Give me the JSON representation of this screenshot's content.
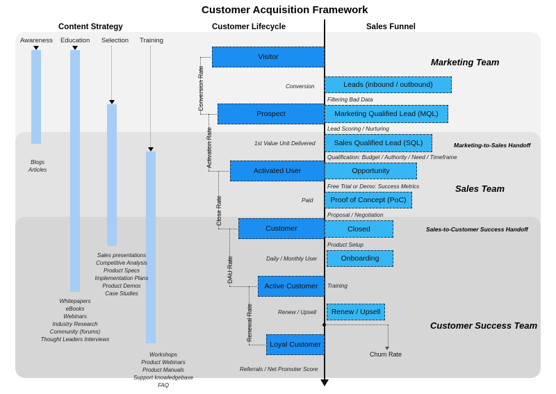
{
  "title": "Customer Acquisition Framework",
  "columns": {
    "content_strategy": "Content Strategy",
    "customer_lifecycle": "Customer Lifecycle",
    "sales_funnel": "Sales Funnel"
  },
  "content_strategy": {
    "stages": [
      {
        "label": "Awareness"
      },
      {
        "label": "Education"
      },
      {
        "label": "Selection"
      },
      {
        "label": "Training"
      }
    ],
    "lists": [
      {
        "name": "awareness-list",
        "text": "Blogs\nArticles"
      },
      {
        "name": "education-list",
        "text": "Whitepapers\neBooks\nWebinars\nIndustry Research\nCommunity (forums)\nThought Leaders Interviews"
      },
      {
        "name": "selection-list",
        "text": "Sales presentations\nCompetitive Analysis\nProduct Specs\nImplementation Plans\nProduct Demos\nCase Studies"
      },
      {
        "name": "training-list",
        "text": "Workshops\nProduct Webinars\nProduct Manuals\nSupport knowledgebase\nFAQ"
      }
    ]
  },
  "lifecycle_boxes": [
    {
      "label": "Visitor"
    },
    {
      "label": "Prospect"
    },
    {
      "label": "Activated User"
    },
    {
      "label": "Customer"
    },
    {
      "label": "Active Customer"
    },
    {
      "label": "Loyal Customer"
    }
  ],
  "funnel_boxes": [
    {
      "label": "Leads (inbound / outbound)"
    },
    {
      "label": "Marketing Qualified Lead (MQL)"
    },
    {
      "label": "Sales Qualified Lead (SQL)"
    },
    {
      "label": "Opportunity"
    },
    {
      "label": "Proof of Concept (PoC)"
    },
    {
      "label": "Closed"
    },
    {
      "label": "Onboarding"
    },
    {
      "label": "Renew / Upsell"
    }
  ],
  "transition_notes": [
    {
      "label": "Conversion"
    },
    {
      "label": "1st Value Unit Delivered"
    },
    {
      "label": "Paid"
    },
    {
      "label": "Daily / Monthly User"
    },
    {
      "label": "Renew / Upsell"
    },
    {
      "label": "Referrals / Net Promoter Score"
    }
  ],
  "funnel_notes": [
    {
      "label": "Filtering Bad Data"
    },
    {
      "label": "Lead Scoring / Nurturing"
    },
    {
      "label": "Qualification: Budget / Authority / Need / Timeframe"
    },
    {
      "label": "Free Trial or Demo: Success Metrics"
    },
    {
      "label": "Proposal / Negotiation"
    },
    {
      "label": "Product Setup"
    },
    {
      "label": "Training"
    }
  ],
  "rates": [
    {
      "label": "Conversion Rate"
    },
    {
      "label": "Activation Rate"
    },
    {
      "label": "Close Rate"
    },
    {
      "label": "DAU Rate"
    },
    {
      "label": "Renewal Rate"
    }
  ],
  "churn": {
    "label": "Churn Rate"
  },
  "teams": [
    {
      "label": "Marketing Team"
    },
    {
      "label": "Sales Team"
    },
    {
      "label": "Customer Success Team"
    }
  ],
  "handoffs": [
    {
      "label": "Marketing-to-Sales Handoff"
    },
    {
      "label": "Sales-to-Customer Success Handoff"
    }
  ],
  "colors": {
    "box_dark": "#1b8ef2",
    "box_light": "#36b6f5",
    "bar": "#a6cdf5",
    "zone_light": "#f2f2f2",
    "zone_mid": "#e3e3e3",
    "zone_dark": "#d6d6d6"
  }
}
